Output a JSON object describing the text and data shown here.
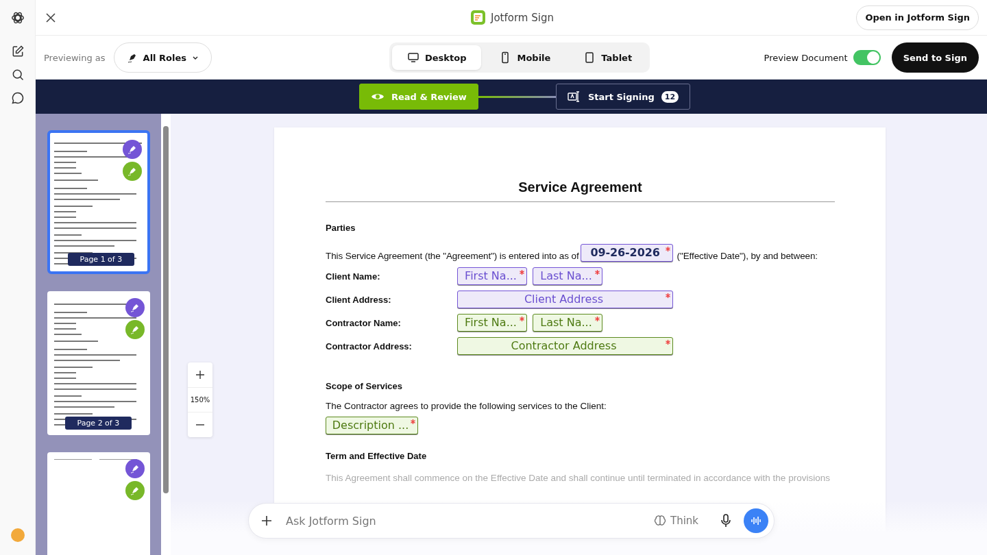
{
  "header": {
    "title": "Jotform Sign",
    "open_button": "Open in Jotform Sign"
  },
  "toolbar": {
    "previewing_label": "Previewing as",
    "role_dropdown": "All Roles",
    "devices": [
      {
        "label": "Desktop",
        "kind": "desktop",
        "selected": true
      },
      {
        "label": "Mobile",
        "kind": "mobile",
        "selected": false
      },
      {
        "label": "Tablet",
        "kind": "tablet",
        "selected": false
      }
    ],
    "preview_toggle": {
      "label": "Preview Document",
      "on": true
    },
    "send_button": "Send to Sign"
  },
  "steps": [
    {
      "label": "Read & Review",
      "kind": "review",
      "selected": true
    },
    {
      "label": "Start Signing",
      "kind": "sign",
      "selected": false,
      "count": "12"
    }
  ],
  "thumbnails": [
    {
      "label": "Page 1 of 3",
      "selected": true,
      "kind": "full"
    },
    {
      "label": "Page 2 of 3",
      "selected": false,
      "kind": "full"
    },
    {
      "selected": false,
      "kind": "sparse"
    }
  ],
  "zoom": {
    "value": "150%"
  },
  "document": {
    "title": "Service Agreement",
    "parties": {
      "heading": "Parties",
      "intro_before": "This Service Agreement (the \"Agreement\") is entered into as of",
      "date_field": {
        "text": "09-26-2026",
        "kind": "date",
        "required": true
      },
      "intro_after": "(\"Effective Date\"), by and between:",
      "rows": [
        {
          "label": "Client Name:",
          "fields": [
            {
              "text": "First Na...",
              "kind": "client",
              "required": true
            },
            {
              "text": "Last Na...",
              "kind": "client",
              "required": true
            }
          ]
        },
        {
          "label": "Client Address:",
          "fields": [
            {
              "text": "Client Address",
              "kind": "client",
              "required": true
            }
          ]
        },
        {
          "label": "Contractor Name:",
          "fields": [
            {
              "text": "First Na...",
              "kind": "contractor",
              "required": true
            },
            {
              "text": "Last Na...",
              "kind": "contractor",
              "required": true
            }
          ]
        },
        {
          "label": "Contractor Address:",
          "fields": [
            {
              "text": "Contractor Address",
              "kind": "contractor",
              "required": true
            }
          ]
        }
      ]
    },
    "scope": {
      "heading": "Scope of Services",
      "text": "The Contractor agrees to provide the following services to the Client:",
      "field": {
        "text": "Description ...",
        "kind": "contractor",
        "required": true
      }
    },
    "term": {
      "heading": "Term and Effective Date",
      "text": "This Agreement shall commence on the Effective Date and shall continue until terminated in accordance with the provisions"
    }
  },
  "chat": {
    "placeholder": "Ask Jotform Sign",
    "think_button": "Think"
  }
}
